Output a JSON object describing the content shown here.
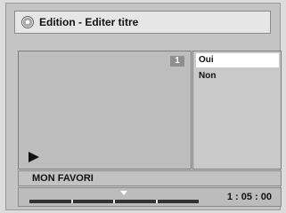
{
  "header": {
    "title": "Edition - Editer titre",
    "icon": "disc-icon"
  },
  "preview": {
    "chapter_number": "1",
    "play_icon": "play-icon"
  },
  "menu": {
    "options": [
      {
        "label": "Oui",
        "selected": true
      },
      {
        "label": "Non",
        "selected": false
      }
    ]
  },
  "title_name": "MON FAVORI",
  "playback": {
    "time": "1 : 05 : 00",
    "position_fraction": 0.56,
    "segments": 4
  }
}
